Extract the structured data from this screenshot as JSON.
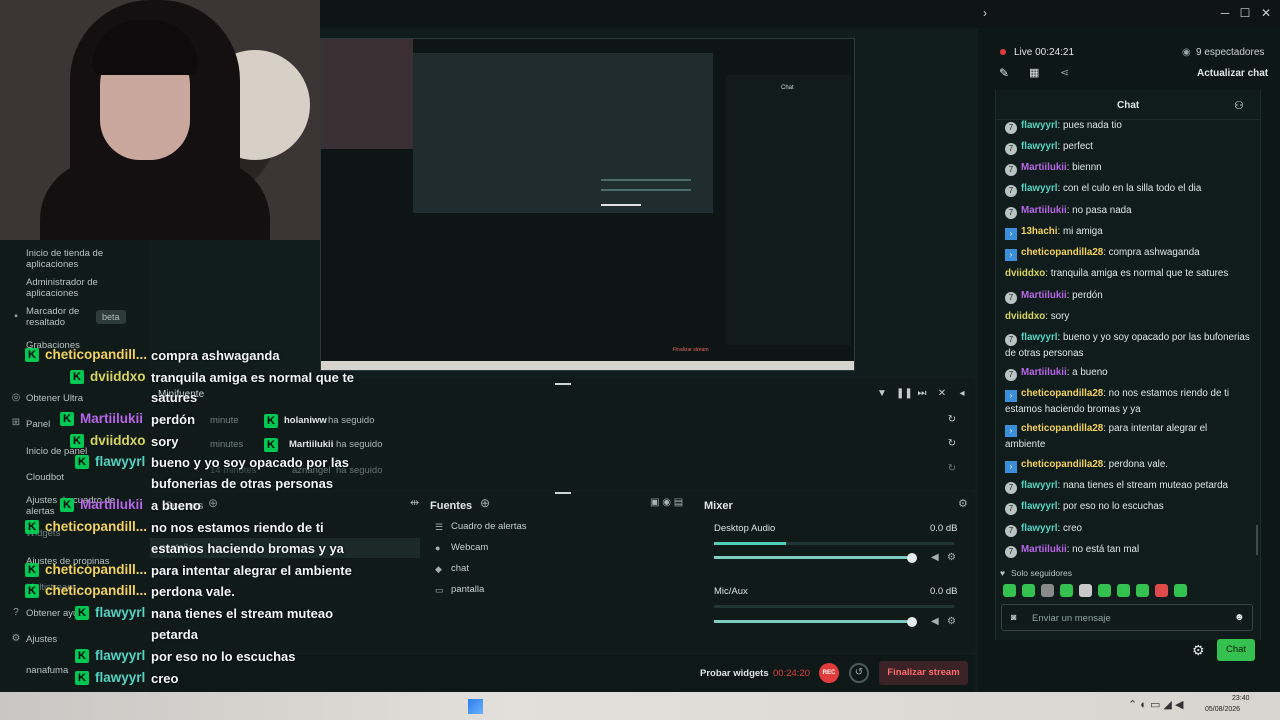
{
  "window": {
    "controls": [
      "─",
      "☐",
      "✕"
    ]
  },
  "preview": {
    "chat_title": "Chat",
    "finish": "Finalizar stream"
  },
  "sidebar": {
    "items": [
      {
        "label": "Inicio de tienda de aplicaciones",
        "icon": "store-icon"
      },
      {
        "label": "Administrador de aplicaciones",
        "icon": "apps-icon"
      },
      {
        "label": "Marcador de resaltado",
        "icon": "bookmark-icon"
      },
      {
        "label": "Grabaciones",
        "icon": "record-icon"
      },
      {
        "label": "Obtener Ultra",
        "icon": "ultra-icon"
      },
      {
        "label": "Panel",
        "icon": "panel-icon"
      },
      {
        "label": "Inicio de panel",
        "icon": "home-icon"
      },
      {
        "label": "Cloudbot",
        "icon": "bot-icon"
      },
      {
        "label": "Ajustes de cuadro de alertas",
        "icon": "alert-icon"
      },
      {
        "label": "Widgets",
        "icon": "widget-icon"
      },
      {
        "label": "Ajustes de propinas",
        "icon": "tip-icon"
      },
      {
        "label": "Multistream",
        "icon": "multistream-icon"
      },
      {
        "label": "Obtener ayuda",
        "icon": "help-icon"
      },
      {
        "label": "Ajustes",
        "icon": "settings-icon"
      },
      {
        "label": "nanafuma",
        "icon": "user-icon"
      }
    ],
    "beta": "beta"
  },
  "overlay_chat": [
    {
      "name": "cheticopandill...",
      "color": "#f2d25a",
      "msg": "compra ashwaganda"
    },
    {
      "name": "dviiddxo",
      "color": "#d9d45c",
      "msg": "tranquila amiga es normal que te"
    },
    {
      "name": "",
      "color": "",
      "msg": "satures"
    },
    {
      "name": "Martiilukii",
      "color": "#b865e8",
      "msg": "perdón"
    },
    {
      "name": "dviiddxo",
      "color": "#d9d45c",
      "msg": "sory"
    },
    {
      "name": "flawyyrl",
      "color": "#52d3c3",
      "msg": "bueno y yo soy opacado por las"
    },
    {
      "name": "",
      "color": "",
      "msg": "bufonerias de otras personas"
    },
    {
      "name": "Martiilukii",
      "color": "#b865e8",
      "msg": "a bueno"
    },
    {
      "name": "cheticopandill...",
      "color": "#f2d25a",
      "msg": "no nos estamos riendo de ti"
    },
    {
      "name": "",
      "color": "",
      "msg": "estamos haciendo bromas y ya"
    },
    {
      "name": "cheticopandill...",
      "color": "#f2d25a",
      "msg": "para intentar alegrar el ambiente"
    },
    {
      "name": "cheticopandill...",
      "color": "#f2d25a",
      "msg": "perdona vale."
    },
    {
      "name": "flawyyrl",
      "color": "#52d3c3",
      "msg": "nana tienes el stream muteao"
    },
    {
      "name": "",
      "color": "",
      "msg": "petarda"
    },
    {
      "name": "flawyyrl",
      "color": "#52d3c3",
      "msg": "por eso no lo escuchas"
    },
    {
      "name": "flawyyrl",
      "color": "#52d3c3",
      "msg": "creo"
    },
    {
      "name": "Martiilukii",
      "color": "#b865e8",
      "msg": "no esta tan mal"
    }
  ],
  "events": {
    "minifuente": "Minifuente",
    "rows": [
      {
        "time": "minute",
        "user": "holaniww",
        "action": "ha seguido"
      },
      {
        "time": "minutes",
        "user": "Martiilukii",
        "action": "ha seguido"
      },
      {
        "time": "14 minutes",
        "user": "aznangel",
        "action": "ha seguido"
      }
    ]
  },
  "docks": {
    "scenes": "Scenes",
    "scene_items": [
      "pantalla"
    ],
    "fuentes": "Fuentes",
    "sources": [
      {
        "label": "Cuadro de alertas",
        "icon": "list-icon"
      },
      {
        "label": "Webcam",
        "icon": "camera-icon"
      },
      {
        "label": "chat",
        "icon": "chat-icon"
      },
      {
        "label": "pantalla",
        "icon": "monitor-icon"
      }
    ],
    "mixer": "Mixer",
    "channels": [
      {
        "label": "Desktop Audio",
        "db": "0.0 dB",
        "level": 0.3
      },
      {
        "label": "Mic/Aux",
        "db": "0.0 dB",
        "level": 0.0
      }
    ]
  },
  "bottom": {
    "probar": "Probar widgets",
    "time": "00:24:20",
    "rec": "REC",
    "finalizar": "Finalizar stream"
  },
  "chat": {
    "live": "Live 00:24:21",
    "viewers": "9 espectadores",
    "refresh": "Actualizar chat",
    "title": "Chat",
    "messages": [
      {
        "badge": "r",
        "name": "flawyyrl",
        "color": "#52d3c3",
        "text": ": pues nada tio"
      },
      {
        "badge": "r",
        "name": "flawyyrl",
        "color": "#52d3c3",
        "text": ": perfect"
      },
      {
        "badge": "r",
        "name": "Martiilukii",
        "color": "#b865e8",
        "text": ": biennn"
      },
      {
        "badge": "r",
        "name": "flawyyrl",
        "color": "#52d3c3",
        "text": ": con el culo en la silla todo el dia"
      },
      {
        "badge": "r",
        "name": "Martiilukii",
        "color": "#b865e8",
        "text": ": no pasa nada"
      },
      {
        "badge": "s",
        "name": "13hachi",
        "color": "#f2d25a",
        "text": ": mi amiga"
      },
      {
        "badge": "s",
        "name": "cheticopandilla28",
        "color": "#f2d25a",
        "text": ": compra ashwaganda"
      },
      {
        "badge": "",
        "name": "dviiddxo",
        "color": "#d9d45c",
        "text": ": tranquila amiga es normal que te satures"
      },
      {
        "badge": "r",
        "name": "Martiilukii",
        "color": "#b865e8",
        "text": ": perdón"
      },
      {
        "badge": "",
        "name": "dviiddxo",
        "color": "#d9d45c",
        "text": ": sory"
      },
      {
        "badge": "r",
        "name": "flawyyrl",
        "color": "#52d3c3",
        "text": ": bueno y yo soy opacado por las bufonerias de otras personas"
      },
      {
        "badge": "r",
        "name": "Martiilukii",
        "color": "#b865e8",
        "text": ": a bueno"
      },
      {
        "badge": "s",
        "name": "cheticopandilla28",
        "color": "#f2d25a",
        "text": ": no nos estamos riendo de ti estamos haciendo bromas y ya"
      },
      {
        "badge": "s",
        "name": "cheticopandilla28",
        "color": "#f2d25a",
        "text": ": para intentar alegrar el ambiente"
      },
      {
        "badge": "s",
        "name": "cheticopandilla28",
        "color": "#f2d25a",
        "text": ": perdona vale."
      },
      {
        "badge": "r",
        "name": "flawyyrl",
        "color": "#52d3c3",
        "text": ": nana tienes el stream muteao petarda"
      },
      {
        "badge": "r",
        "name": "flawyyrl",
        "color": "#52d3c3",
        "text": ": por eso no lo escuchas"
      },
      {
        "badge": "r",
        "name": "flawyyrl",
        "color": "#52d3c3",
        "text": ": creo"
      },
      {
        "badge": "r",
        "name": "Martiilukii",
        "color": "#b865e8",
        "text": ": no está tan mal"
      }
    ],
    "followers_only": "Solo seguidores",
    "input_placeholder": "Enviar un mensaje",
    "send": "Chat"
  },
  "taskbar": {
    "time": "23:40",
    "date": "05/08/2026"
  },
  "colors": {
    "accent": "#35c14f",
    "rec": "#e23b3b",
    "live": "#e23b3b"
  }
}
